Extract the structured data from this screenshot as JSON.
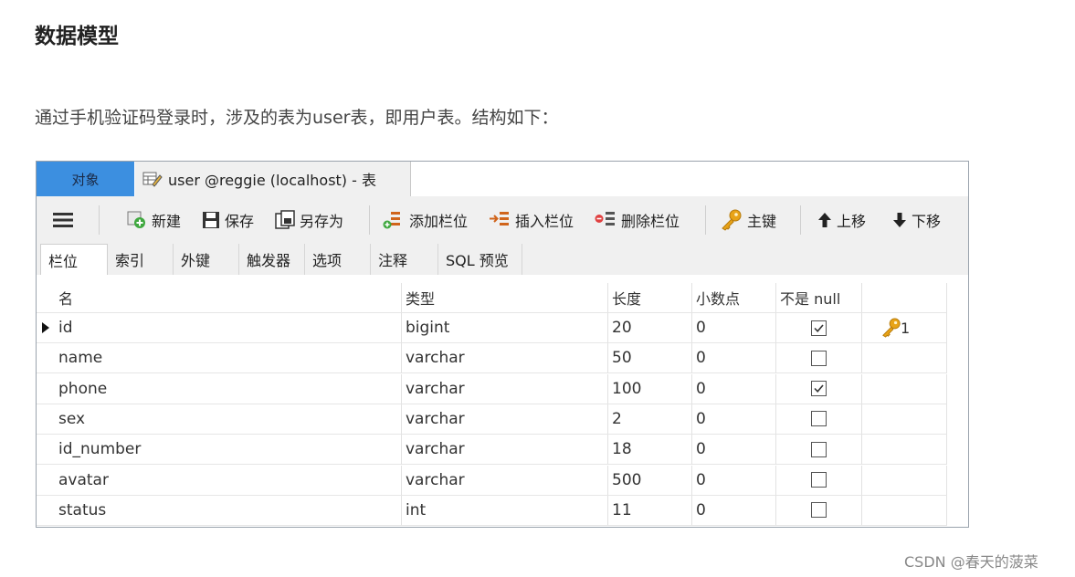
{
  "heading": "数据模型",
  "intro": "通过手机验证码登录时，涉及的表为user表，即用户表。结构如下：",
  "window": {
    "tab_objects": "对象",
    "tab_table": "user @reggie (localhost) - 表"
  },
  "toolbar": {
    "new": "新建",
    "save": "保存",
    "save_as": "另存为",
    "add_column": "添加栏位",
    "insert_column": "插入栏位",
    "delete_column": "删除栏位",
    "primary_key": "主键",
    "move_up": "上移",
    "move_down": "下移"
  },
  "subtabs": [
    "栏位",
    "索引",
    "外键",
    "触发器",
    "选项",
    "注释",
    "SQL 预览"
  ],
  "grid": {
    "headers": [
      "名",
      "类型",
      "长度",
      "小数点",
      "不是 null",
      ""
    ],
    "rows": [
      {
        "name": "id",
        "type": "bigint",
        "length": "20",
        "decimal": "0",
        "not_null": true,
        "key": "1"
      },
      {
        "name": "name",
        "type": "varchar",
        "length": "50",
        "decimal": "0",
        "not_null": false,
        "key": ""
      },
      {
        "name": "phone",
        "type": "varchar",
        "length": "100",
        "decimal": "0",
        "not_null": true,
        "key": ""
      },
      {
        "name": "sex",
        "type": "varchar",
        "length": "2",
        "decimal": "0",
        "not_null": false,
        "key": ""
      },
      {
        "name": "id_number",
        "type": "varchar",
        "length": "18",
        "decimal": "0",
        "not_null": false,
        "key": ""
      },
      {
        "name": "avatar",
        "type": "varchar",
        "length": "500",
        "decimal": "0",
        "not_null": false,
        "key": ""
      },
      {
        "name": "status",
        "type": "int",
        "length": "11",
        "decimal": "0",
        "not_null": false,
        "key": ""
      }
    ]
  },
  "watermark": "CSDN @春天的菠菜"
}
